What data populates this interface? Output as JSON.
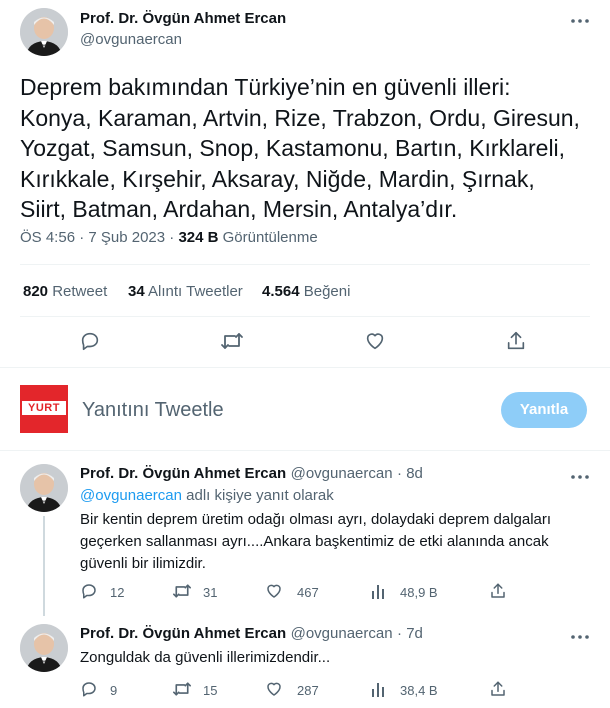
{
  "main_tweet": {
    "author_name": "Prof. Dr. Övgün Ahmet Ercan",
    "author_handle": "@ovgunaercan",
    "text": "Deprem bakımından Türkiye’nin en güvenli illeri: Konya, Karaman, Artvin, Rize, Trabzon, Ordu, Giresun, Yozgat, Samsun, Snop, Kastamonu, Bartın, Kırklareli, Kırıkkale, Kırşehir, Aksaray, Niğde, Mardin, Şırnak, Siirt, Batman, Ardahan, Mersin, Antalya’dır.",
    "timestamp": "ÖS 4:56 · 7 Şub 2023 ·",
    "views_count": "324 B",
    "views_label": "Görüntülenme",
    "stats": {
      "retweets_count": "820",
      "retweets_label": "Retweet",
      "quotes_count": "34",
      "quotes_label": "Alıntı Tweetler",
      "likes_count": "4.564",
      "likes_label": "Beğeni"
    }
  },
  "composer": {
    "avatar_text": "YURT",
    "placeholder": "Yanıtını Tweetle",
    "button_label": "Yanıtla"
  },
  "replies": [
    {
      "author_name": "Prof. Dr. Övgün Ahmet Ercan",
      "author_handle": "@ovgunaercan",
      "time": "· 8d",
      "replying_handle": "@ovgunaercan",
      "replying_suffix": " adlı kişiye yanıt olarak",
      "text": "Bir kentin deprem üretim odağı olması ayrı, dolaydaki deprem dalgaları geçerken sallanması ayrı....Ankara başkentimiz de etki alanında ancak güvenli bir ilimizdir.",
      "replies": "12",
      "retweets": "31",
      "likes": "467",
      "views": "48,9 B"
    },
    {
      "author_name": "Prof. Dr. Övgün Ahmet Ercan",
      "author_handle": "@ovgunaercan",
      "time": "· 7d",
      "text": "Zonguldak da güvenli illerimizdendir...",
      "replies": "9",
      "retweets": "15",
      "likes": "287",
      "views": "38,4 B"
    }
  ],
  "colors": {
    "accent": "#1d9bf0",
    "button_disabled": "#8ecdf8",
    "secondary_text": "#536471",
    "divider": "#eff3f4",
    "brand_red": "#e3262b"
  },
  "icons": [
    "more-icon",
    "reply-icon",
    "retweet-icon",
    "like-icon",
    "share-icon",
    "views-icon"
  ]
}
